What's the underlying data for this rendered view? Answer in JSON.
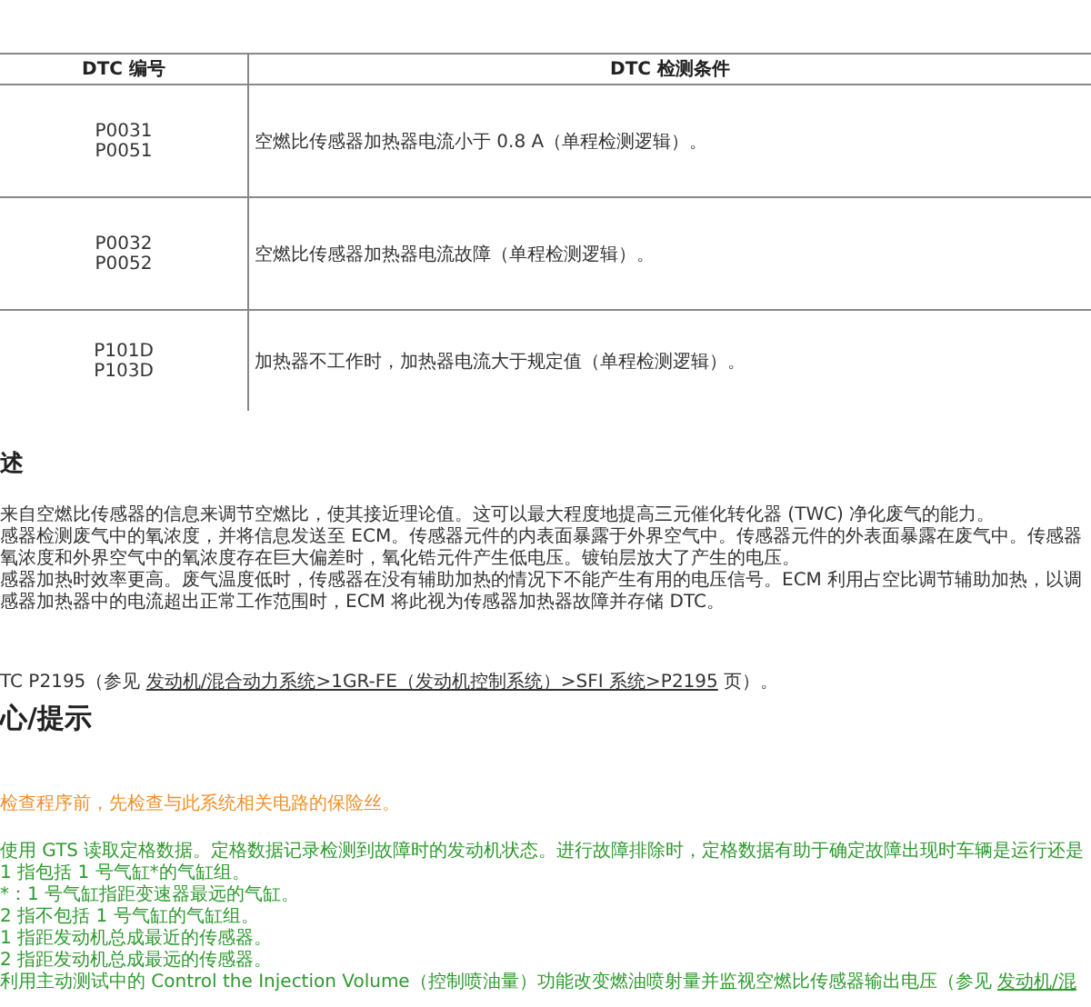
{
  "dtc_table": {
    "columns": [
      "DTC 编号",
      "DTC 检测条件"
    ],
    "rows": [
      {
        "codes": [
          "P0031",
          "P0051"
        ],
        "condition": "空燃比传感器加热器电流小于 0.8 A（单程检测逻辑）。"
      },
      {
        "codes": [
          "P0032",
          "P0052"
        ],
        "condition": "空燃比传感器加热器电流故障（单程检测逻辑）。"
      },
      {
        "codes": [
          "P101D",
          "P103D"
        ],
        "condition": "加热器不工作时，加热器电流大于规定值（单程检测逻辑）。"
      }
    ]
  },
  "description": {
    "heading": "述",
    "lines": [
      "来自空燃比传感器的信息来调节空燃比，使其接近理论值。这可以最大程度地提高三元催化转化器 (TWC) 净化废气的能力。",
      "感器检测废气中的氧浓度，并将信息发送至 ECM。传感器元件的内表面暴露于外界空气中。传感器元件的外表面暴露在废气中。传感器",
      "氧浓度和外界空气中的氧浓度存在巨大偏差时，氧化锆元件产生低电压。镀铂层放大了产生的电压。",
      "感器加热时效率更高。废气温度低时，传感器在没有辅助加热的情况下不能产生有用的电压信号。ECM 利用占空比调节辅助加热，以调",
      "感器加热器中的电流超出正常工作范围时，ECM 将此视为传感器加热器故障并存储 DTC。"
    ]
  },
  "reference": {
    "before": "TC P2195（参见 ",
    "link": "发动机/混合动力系统>1GR-FE（发动机控制系统）>SFI 系统>P2195",
    "after": " 页）。"
  },
  "caution": {
    "heading": "心/提示",
    "notice": "检查程序前，先检查与此系统相关电路的保险丝。",
    "hints": [
      "使用 GTS 读取定格数据。定格数据记录检测到故障时的发动机状态。进行故障排除时，定格数据有助于确定故障出现时车辆是运行还是",
      "1 指包括 1 号气缸*的气缸组。",
      "*：1 号气缸指距变速器最远的气缸。",
      "2 指不包括 1 号气缸的气缸组。",
      "1 指距发动机总成最近的传感器。",
      "2 指距发动机总成最远的传感器。"
    ],
    "last_hint": {
      "before": "利用主动测试中的 Control the Injection Volume（控制喷油量）功能改变燃油喷射量并监视空燃比传感器输出电压（参见 ",
      "link": "发动机/混"
    }
  }
}
